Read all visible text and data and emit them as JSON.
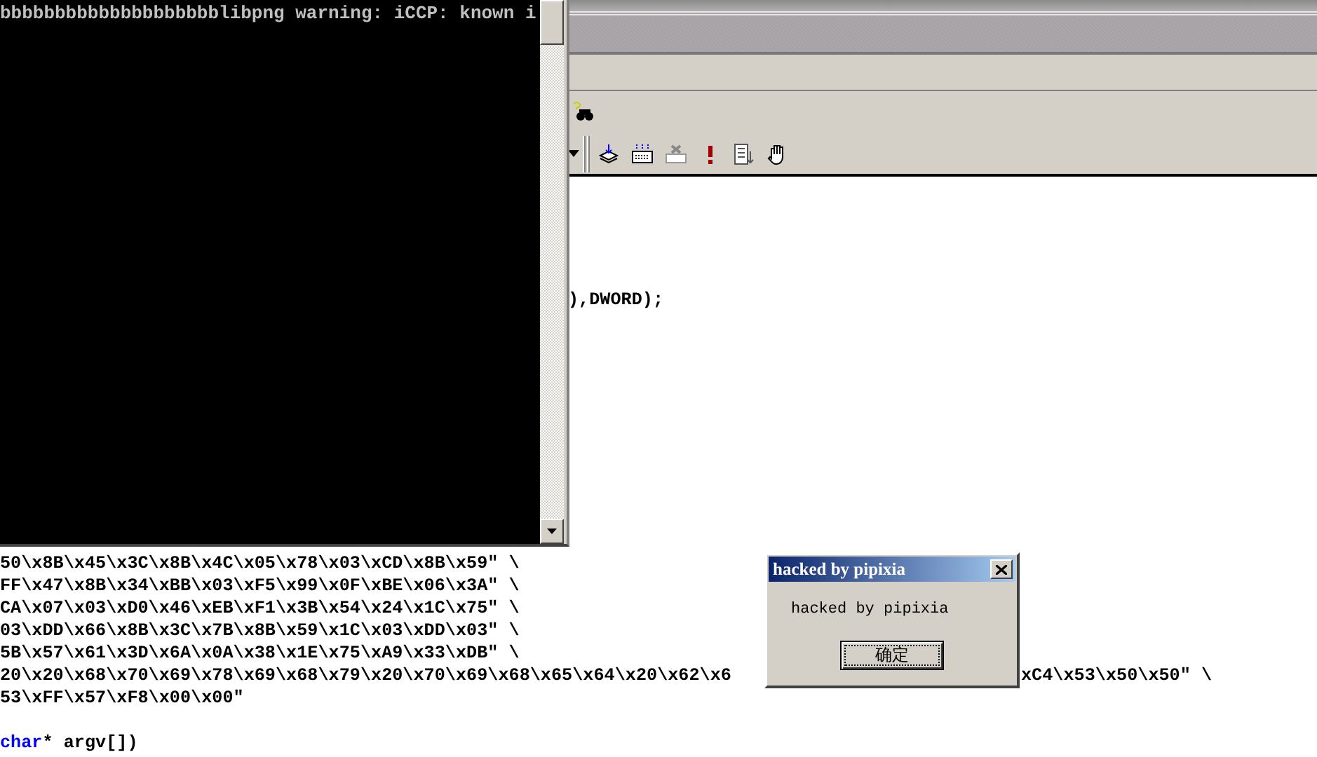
{
  "console": {
    "lines": [
      "bbbbbbbbbbbbbbbbbbbblibpng warning: iCCP: known i"
    ]
  },
  "editor": {
    "top_lines": [
      {
        "kind": "code",
        "segments": [
          {
            "kind": "plain",
            "text": "),DWORD);"
          }
        ]
      }
    ],
    "bottom_lines": [
      {
        "kind": "code",
        "segments": [
          {
            "kind": "plain",
            "text": "50\\x8B\\x45\\x3C\\x8B\\x4C\\x05\\x78\\x03\\xCD\\x8B\\x59\" \\"
          }
        ]
      },
      {
        "kind": "code",
        "segments": [
          {
            "kind": "plain",
            "text": "FF\\x47\\x8B\\x34\\xBB\\x03\\xF5\\x99\\x0F\\xBE\\x06\\x3A\" \\"
          }
        ]
      },
      {
        "kind": "code",
        "segments": [
          {
            "kind": "plain",
            "text": "CA\\x07\\x03\\xD0\\x46\\xEB\\xF1\\x3B\\x54\\x24\\x1C\\x75\" \\"
          }
        ]
      },
      {
        "kind": "code",
        "segments": [
          {
            "kind": "plain",
            "text": "03\\xDD\\x66\\x8B\\x3C\\x7B\\x8B\\x59\\x1C\\x03\\xDD\\x03\" \\"
          }
        ]
      },
      {
        "kind": "code",
        "segments": [
          {
            "kind": "plain",
            "text": "5B\\x57\\x61\\x3D\\x6A\\x0A\\x38\\x1E\\x75\\xA9\\x33\\xDB\" \\"
          }
        ]
      },
      {
        "kind": "split",
        "left": "20\\x20\\x68\\x70\\x69\\x78\\x69\\x68\\x79\\x20\\x70\\x69\\x68\\x65\\x64\\x20\\x62\\x6",
        "right": "xC4\\x53\\x50\\x50\" \\"
      },
      {
        "kind": "code",
        "segments": [
          {
            "kind": "plain",
            "text": "53\\xFF\\x57\\xF8\\x00\\x00\""
          }
        ]
      },
      {
        "kind": "blank"
      },
      {
        "kind": "code",
        "segments": [
          {
            "kind": "keyword",
            "text": "char"
          },
          {
            "kind": "plain",
            "text": "* argv[])"
          }
        ]
      }
    ]
  },
  "dialog": {
    "title": "hacked by pipixia",
    "message": "hacked by pipixia",
    "buttons": [
      {
        "label": "确定",
        "focused": true
      }
    ]
  }
}
